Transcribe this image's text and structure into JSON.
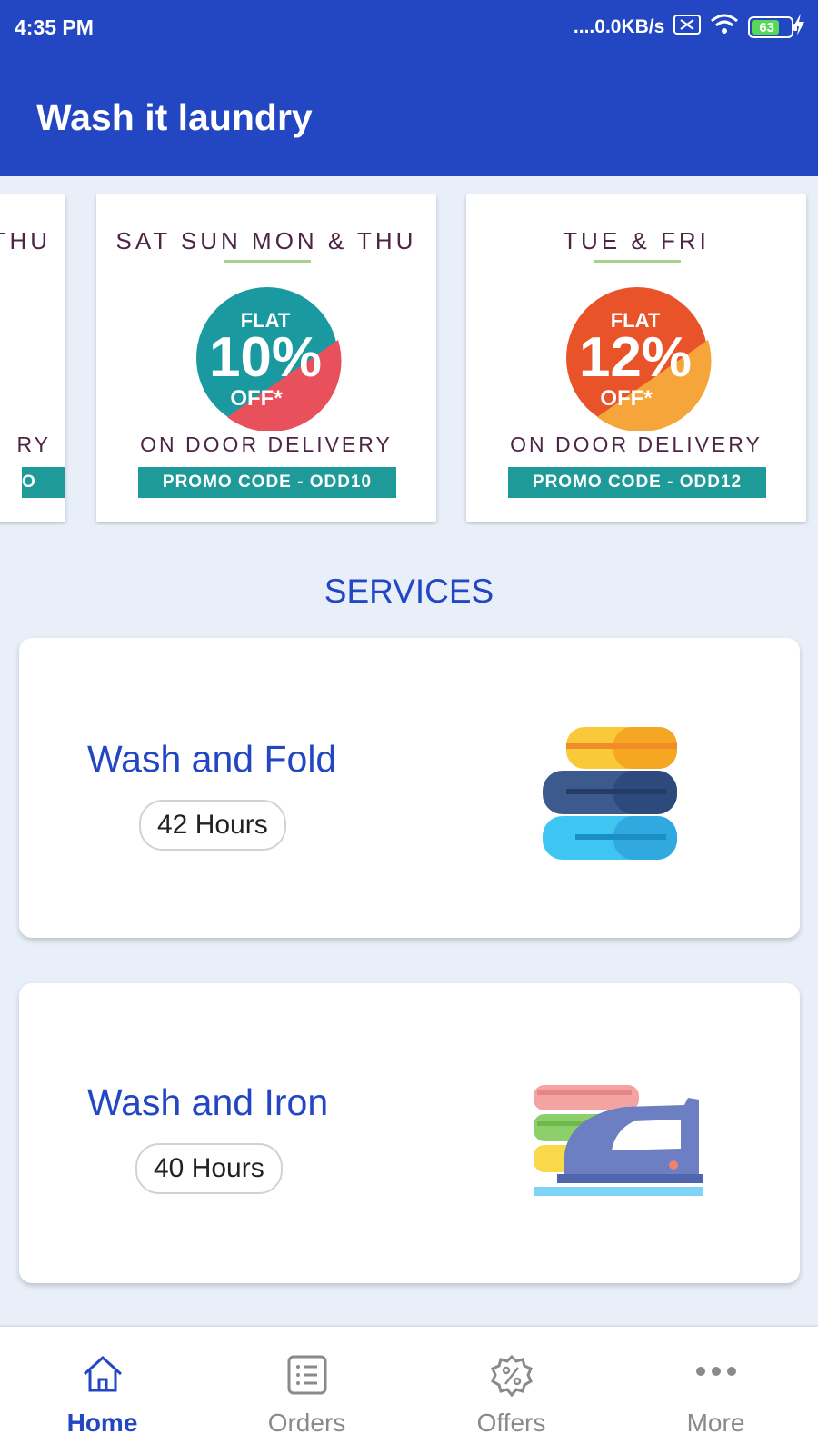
{
  "status": {
    "time": "4:35 PM",
    "network_speed": "....0.0KB/s",
    "battery": "63"
  },
  "app": {
    "title": "Wash it laundry"
  },
  "promos": [
    {
      "days": "THU",
      "delivery": "RY",
      "code": "O"
    },
    {
      "days": "SAT SUN MON & THU",
      "flat": "FLAT",
      "percent": "10%",
      "off": "OFF*",
      "delivery": "ON DOOR DELIVERY",
      "code": "PROMO CODE - ODD10",
      "colors": [
        "#1a9aa0",
        "#e8505b"
      ]
    },
    {
      "days": "TUE & FRI",
      "flat": "FLAT",
      "percent": "12%",
      "off": "OFF*",
      "delivery": "ON DOOR DELIVERY",
      "code": "PROMO CODE - ODD12",
      "colors": [
        "#e8532a",
        "#f5a53a"
      ]
    }
  ],
  "services": {
    "title": "SERVICES",
    "items": [
      {
        "name": "Wash and Fold",
        "hours": "42 Hours",
        "icon": "folded-towels-icon"
      },
      {
        "name": "Wash and Iron",
        "hours": "40 Hours",
        "icon": "iron-clothes-icon"
      }
    ]
  },
  "nav": {
    "items": [
      {
        "label": "Home",
        "icon": "home-icon",
        "active": true
      },
      {
        "label": "Orders",
        "icon": "list-icon",
        "active": false
      },
      {
        "label": "Offers",
        "icon": "discount-badge-icon",
        "active": false
      },
      {
        "label": "More",
        "icon": "more-dots-icon",
        "active": false
      }
    ]
  },
  "colors": {
    "primary": "#2347c2",
    "background": "#e8eff9",
    "promo_teal": "#1e9a98"
  }
}
